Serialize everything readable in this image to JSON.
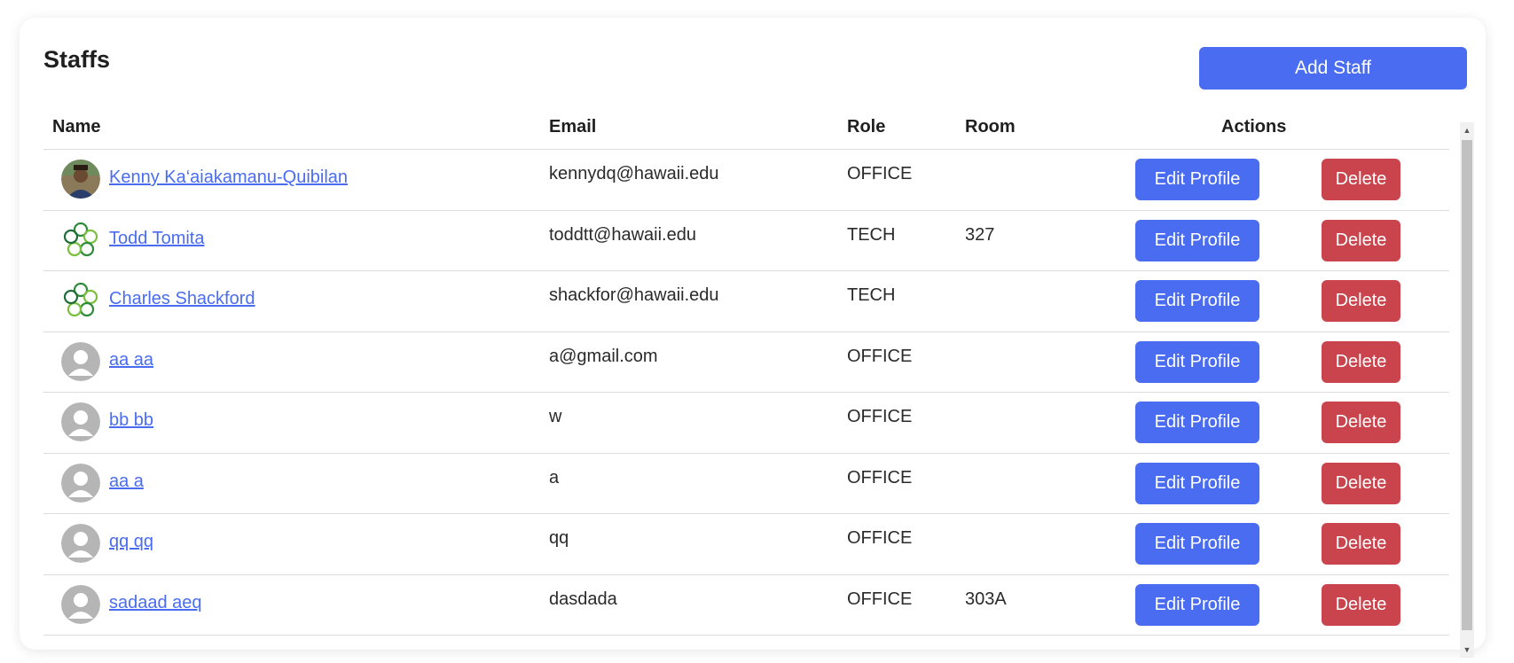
{
  "page": {
    "title": "Staffs",
    "add_button": "Add Staff"
  },
  "table": {
    "headers": {
      "name": "Name",
      "email": "Email",
      "role": "Role",
      "room": "Room",
      "actions": "Actions"
    },
    "rows": [
      {
        "name": "Kenny Ka‘aiakamanu-Quibilan",
        "email": "kennydq@hawaii.edu",
        "role": "OFFICE",
        "room": "",
        "avatar": "photo",
        "edit": "Edit Profile",
        "delete": "Delete"
      },
      {
        "name": "Todd Tomita",
        "email": "toddtt@hawaii.edu",
        "role": "TECH",
        "room": "327",
        "avatar": "flower-logo",
        "edit": "Edit Profile",
        "delete": "Delete"
      },
      {
        "name": "Charles Shackford",
        "email": "shackfor@hawaii.edu",
        "role": "TECH",
        "room": "",
        "avatar": "flower-logo",
        "edit": "Edit Profile",
        "delete": "Delete"
      },
      {
        "name": "aa aa",
        "email": "a@gmail.com",
        "role": "OFFICE",
        "room": "",
        "avatar": "default",
        "edit": "Edit Profile",
        "delete": "Delete"
      },
      {
        "name": "bb bb",
        "email": "w",
        "role": "OFFICE",
        "room": "",
        "avatar": "default",
        "edit": "Edit Profile",
        "delete": "Delete"
      },
      {
        "name": "aa a",
        "email": "a",
        "role": "OFFICE",
        "room": "",
        "avatar": "default",
        "edit": "Edit Profile",
        "delete": "Delete"
      },
      {
        "name": "qq qq",
        "email": "qq",
        "role": "OFFICE",
        "room": "",
        "avatar": "default",
        "edit": "Edit Profile",
        "delete": "Delete"
      },
      {
        "name": "sadaad aeq",
        "email": "dasdada",
        "role": "OFFICE",
        "room": "303A",
        "avatar": "default",
        "edit": "Edit Profile",
        "delete": "Delete"
      }
    ]
  },
  "colors": {
    "primary": "#4a6cf0",
    "danger": "#c9444d",
    "link": "#4a6cf0"
  }
}
